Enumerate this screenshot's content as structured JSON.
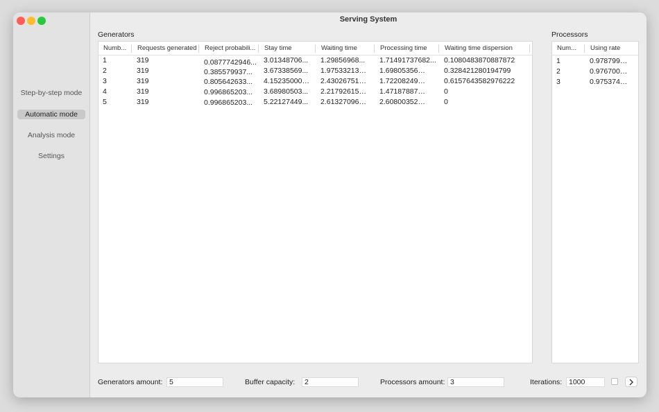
{
  "window": {
    "title": "Serving System"
  },
  "sidebar": {
    "items": [
      {
        "label": "Step-by-step mode",
        "active": false
      },
      {
        "label": "Automatic mode",
        "active": true
      },
      {
        "label": "Analysis mode",
        "active": false
      },
      {
        "label": "Settings",
        "active": false
      }
    ]
  },
  "generators": {
    "title": "Generators",
    "columns": [
      "Numb...",
      "Requests generated",
      "Reject probabili...",
      "Stay time",
      "Waiting time",
      "Processing time",
      "Waiting time dispersion"
    ],
    "rows": [
      [
        "1",
        "319",
        "0.0877742946...",
        "3.01348706...",
        "1.29856968...",
        "1.71491737682...",
        "0.1080483870887872"
      ],
      [
        "2",
        "319",
        "0.385579937...",
        "3.67338569...",
        "1.97533213…",
        "1.69805356…",
        "0.328421280194799"
      ],
      [
        "3",
        "319",
        "0.805642633...",
        "4.15235000…",
        "2.43026751…",
        "1.72208249…",
        "0.6157643582976222"
      ],
      [
        "4",
        "319",
        "0.996865203...",
        "3.68980503...",
        "2.21792615…",
        "1.47187887…",
        "0"
      ],
      [
        "5",
        "319",
        "0.996865203...",
        "5.22127449...",
        "2.61327096…",
        "2.60800352…",
        "0"
      ]
    ]
  },
  "processors": {
    "title": "Processors",
    "columns": [
      "Num...",
      "Using rate"
    ],
    "rows": [
      [
        "1",
        "0.978799…"
      ],
      [
        "2",
        "0.976700…"
      ],
      [
        "3",
        "0.975374…"
      ]
    ]
  },
  "footer": {
    "generators_label": "Generators amount:",
    "generators_value": "5",
    "buffer_label": "Buffer capacity:",
    "buffer_value": "2",
    "processors_label": "Processors amount:",
    "processors_value": "3",
    "iterations_label": "Iterations:",
    "iterations_value": "1000",
    "next_icon": "chevron-right-icon"
  }
}
